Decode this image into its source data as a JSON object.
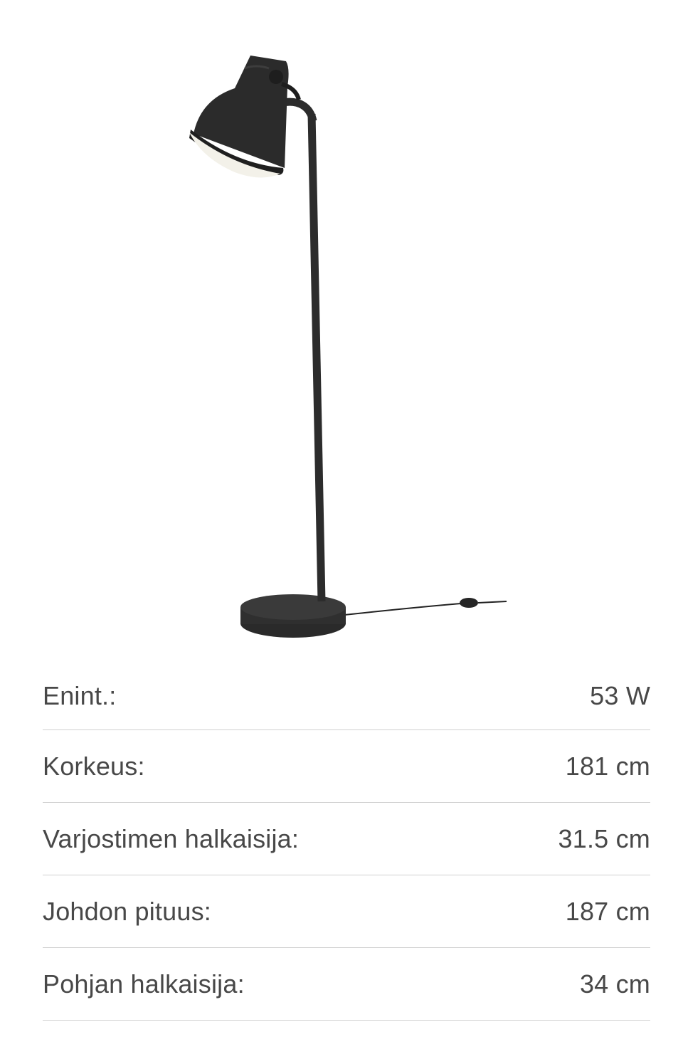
{
  "product": {
    "image_name": "floor-lamp-image"
  },
  "specs": [
    {
      "label": "Enint.:",
      "value": "53 W"
    },
    {
      "label": "Korkeus:",
      "value": "181 cm"
    },
    {
      "label": "Varjostimen halkaisija:",
      "value": "31.5 cm"
    },
    {
      "label": "Johdon pituus:",
      "value": "187 cm"
    },
    {
      "label": "Pohjan halkaisija:",
      "value": "34 cm"
    }
  ]
}
